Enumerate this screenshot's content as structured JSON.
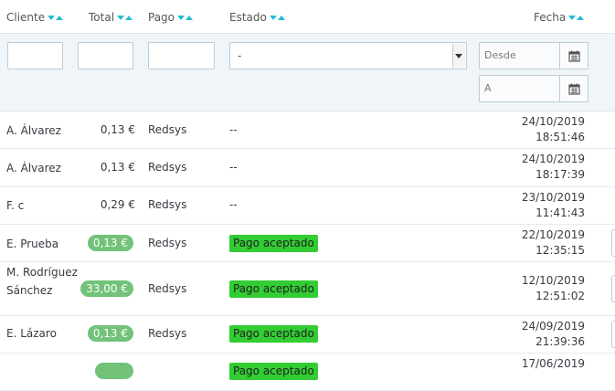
{
  "columns": {
    "cliente": "Cliente",
    "total": "Total",
    "pago": "Pago",
    "estado": "Estado",
    "fecha": "Fecha"
  },
  "filters": {
    "estado_selected": "-",
    "desde_placeholder": "Desde",
    "hasta_placeholder": "A"
  },
  "orders": [
    {
      "cliente": "A. Álvarez",
      "total": "0,13 €",
      "pago": "Redsys",
      "estado": "--",
      "fecha": "24/10/2019",
      "hora": "18:51:46"
    },
    {
      "cliente": "A. Álvarez",
      "total": "0,13 €",
      "pago": "Redsys",
      "estado": "--",
      "fecha": "24/10/2019",
      "hora": "18:17:39"
    },
    {
      "cliente": "F. c",
      "total": "0,29 €",
      "pago": "Redsys",
      "estado": "--",
      "fecha": "23/10/2019",
      "hora": "11:41:43"
    },
    {
      "cliente": "E. Prueba",
      "total": "0,13 €",
      "pago": "Redsys",
      "estado": "Pago aceptado",
      "fecha": "22/10/2019",
      "hora": "12:35:15"
    },
    {
      "cliente": "M. Rodríguez Sánchez",
      "total": "33,00 €",
      "pago": "Redsys",
      "estado": "Pago aceptado",
      "fecha": "12/10/2019",
      "hora": "12:51:02"
    },
    {
      "cliente": "E. Lázaro",
      "total": "0,13 €",
      "pago": "Redsys",
      "estado": "Pago aceptado",
      "fecha": "24/09/2019",
      "hora": "21:39:36"
    },
    {
      "cliente": "",
      "total": "",
      "pago": "",
      "estado": "Pago aceptado",
      "fecha": "17/06/2019",
      "hora": ""
    }
  ],
  "colors": {
    "accent": "#25b9d7",
    "total_pill": "#72c279",
    "status_accepted": "#32cd32",
    "filter_bg": "#eff5f9"
  },
  "icons": {
    "sort": "sort-arrows-icon",
    "calendar": "calendar-icon",
    "select_arrow": "chevron-down-icon"
  }
}
